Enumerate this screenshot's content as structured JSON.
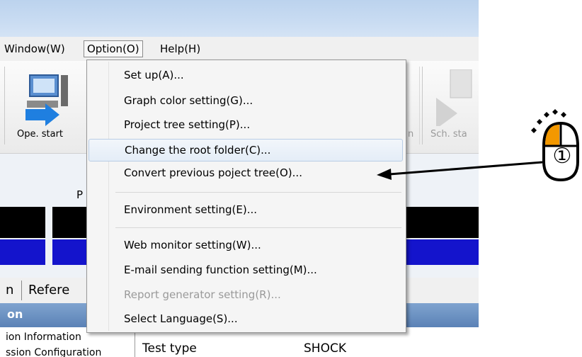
{
  "menubar": {
    "items": [
      {
        "label": "Window(W)"
      },
      {
        "label": "Option(O)"
      },
      {
        "label": "Help(H)"
      }
    ]
  },
  "toolbar": {
    "ope_start_label": "Ope. start",
    "hidden_label": "n",
    "sch_start_label": "Sch. sta"
  },
  "panel": {
    "p_label": "P",
    "tabs": [
      {
        "label": "n"
      },
      {
        "label": "Refere"
      }
    ],
    "header": "on",
    "left_lines": [
      "ion Information",
      "ssion Configuration"
    ],
    "test_type_label": "Test type",
    "test_type_value": "SHOCK"
  },
  "option_menu": {
    "items": [
      {
        "label": "Set up(A)..."
      },
      {
        "label": "Graph color setting(G)..."
      },
      {
        "label": "Project tree setting(P)..."
      },
      {
        "label": "Change the root folder(C)...",
        "highlighted": true
      },
      {
        "label": "Convert previous poject tree(O)..."
      },
      {
        "label": "Environment setting(E)..."
      },
      {
        "label": "Web monitor setting(W)..."
      },
      {
        "label": "E-mail sending function setting(M)..."
      },
      {
        "label": "Report generator setting(R)...",
        "disabled": true
      },
      {
        "label": "Select Language(S)..."
      }
    ]
  },
  "annotation": {
    "step_number": "①",
    "colors": {
      "accent_orange": "#f39800",
      "band_blue": "#1414cc",
      "header_blue": "#5b82b6"
    }
  }
}
